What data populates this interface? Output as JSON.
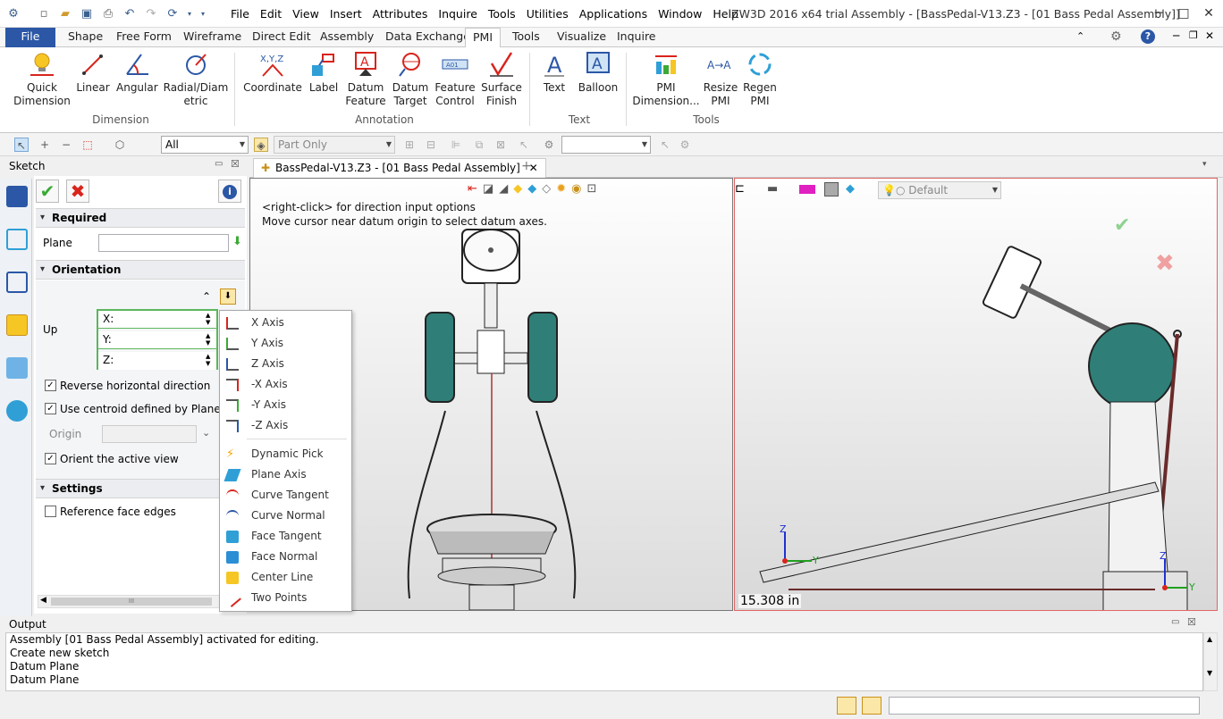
{
  "menu": [
    "File",
    "Edit",
    "View",
    "Insert",
    "Attributes",
    "Inquire",
    "Tools",
    "Utilities",
    "Applications",
    "Window",
    "Help"
  ],
  "window_title": "ZW3D 2016  x64 trial      Assembly - [BassPedal-V13.Z3 - [01 Bass Pedal Assembly]]",
  "tabs": [
    "File",
    "Shape",
    "Free Form",
    "Wireframe",
    "Direct Edit",
    "Assembly",
    "Data Exchange",
    "PMI",
    "Tools",
    "Visualize",
    "Inquire"
  ],
  "ribbon": {
    "dimension": {
      "group": "Dimension",
      "buttons": [
        "Quick\nDimension",
        "Linear",
        "Angular",
        "Radial/Diam\netric"
      ]
    },
    "annotation": {
      "group": "Annotation",
      "buttons": [
        "Coordinate",
        "Label",
        "Datum\nFeature",
        "Datum\nTarget",
        "Feature\nControl",
        "Surface\nFinish"
      ]
    },
    "text": {
      "group": "Text",
      "buttons": [
        "Text",
        "Balloon"
      ]
    },
    "tools": {
      "group": "Tools",
      "buttons": [
        "PMI\nDimension...",
        "Resize\nPMI",
        "Regen\nPMI"
      ]
    }
  },
  "toolbar": {
    "filter_value": "All",
    "scope_value": "Part Only",
    "blank_combo": ""
  },
  "sketch_panel": {
    "title": "Sketch",
    "required": "Required",
    "plane_label": "Plane",
    "plane_value": "",
    "orientation": "Orientation",
    "up_label": "Up",
    "x_label": "X:",
    "y_label": "Y:",
    "z_label": "Z:",
    "reverse_label": "Reverse horizontal direction",
    "centroid_label": "Use centroid defined by Plane",
    "origin_label": "Origin",
    "orient_label": "Orient the active view",
    "settings": "Settings",
    "ref_edges_label": "Reference face edges",
    "scroll_thumb": "III"
  },
  "popup_menu": [
    "X Axis",
    "Y Axis",
    "Z Axis",
    "-X Axis",
    "-Y Axis",
    "-Z Axis",
    "Dynamic Pick",
    "Plane Axis",
    "Curve Tangent",
    "Curve Normal",
    "Face Tangent",
    "Face Normal",
    "Center Line",
    "Two Points"
  ],
  "document_tab": "BassPedal-V13.Z3 - [01 Bass Pedal Assembly]",
  "viewport_hint": [
    "<right-click> for direction input options",
    "Move cursor near datum origin to select datum axes."
  ],
  "viewport2": {
    "style_value": "Default",
    "measure": "15.308 in",
    "axis_labels": {
      "x": "X",
      "y": "Y",
      "z": "Z"
    }
  },
  "output": {
    "title": "Output",
    "lines": [
      "Assembly [01 Bass Pedal Assembly] activated for editing.",
      "Create new sketch",
      "Datum Plane",
      "Datum Plane"
    ]
  },
  "colors": {
    "accent": "#2b57a6",
    "teal": "#2f7f78",
    "green_check": "#3aaa35",
    "red_x": "#d9241c"
  }
}
